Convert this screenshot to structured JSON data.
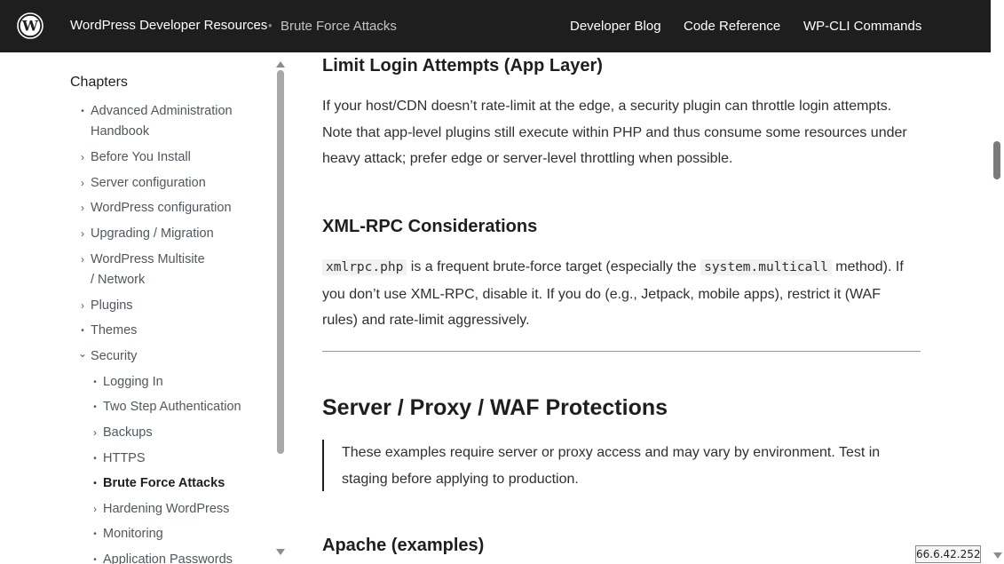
{
  "header": {
    "site_title": "WordPress Developer Resources",
    "separator": "•",
    "breadcrumb": "Brute Force Attacks",
    "nav": [
      "Developer Blog",
      "Code Reference",
      "WP-CLI Commands"
    ]
  },
  "sidebar": {
    "title": "Chapters",
    "items": [
      {
        "marker": "•",
        "lines": [
          "Advanced Administration",
          "Handbook"
        ]
      },
      {
        "marker": "›",
        "lines": [
          "Before You Install"
        ]
      },
      {
        "marker": "›",
        "lines": [
          "Server configuration"
        ]
      },
      {
        "marker": "›",
        "lines": [
          "WordPress configuration"
        ]
      },
      {
        "marker": "›",
        "lines": [
          "Upgrading / Migration"
        ]
      },
      {
        "marker": "›",
        "lines": [
          "WordPress Multisite",
          "/ Network"
        ]
      },
      {
        "marker": "›",
        "lines": [
          "Plugins"
        ]
      },
      {
        "marker": "•",
        "lines": [
          "Themes"
        ]
      },
      {
        "marker": "⌄",
        "lines": [
          "Security"
        ]
      },
      {
        "marker": "•",
        "lines": [
          "Logging In"
        ]
      },
      {
        "marker": "•",
        "lines": [
          "Two Step Authentication"
        ]
      },
      {
        "marker": "›",
        "lines": [
          "Backups"
        ]
      },
      {
        "marker": "•",
        "lines": [
          "HTTPS"
        ]
      },
      {
        "marker": "•",
        "lines": [
          "Brute Force Attacks"
        ]
      },
      {
        "marker": "›",
        "lines": [
          "Hardening WordPress"
        ]
      },
      {
        "marker": "•",
        "lines": [
          "Monitoring"
        ]
      },
      {
        "marker": "•",
        "lines": [
          "Application Passwords"
        ]
      }
    ]
  },
  "content": {
    "h_limit": "Limit Login Attempts (App Layer)",
    "p_limit": "If your host/CDN doesn’t rate-limit at the edge, a security plugin can throttle login attempts. Note that app-level plugins still execute within PHP and thus consume some resources under heavy attack; prefer edge or server-level throttling when possible.",
    "h_xmlrpc": "XML-RPC Considerations",
    "code_xmlrpc": "xmlrpc.php",
    "p_xmlrpc_a": " is a frequent brute-force target (especially the ",
    "code_multicall": "system.multicall",
    "p_xmlrpc_b": " method). If you don’t use XML-RPC, disable it. If you do (e.g., Jetpack, mobile apps), restrict it (WAF rules) and rate-limit aggressively.",
    "h_server": "Server / Proxy / WAF Protections",
    "quote": "These examples require server or proxy access and may vary by environment. Test in staging before applying to production.",
    "h_apache": "Apache (examples)"
  },
  "ip_badge": "66.6.42.252"
}
